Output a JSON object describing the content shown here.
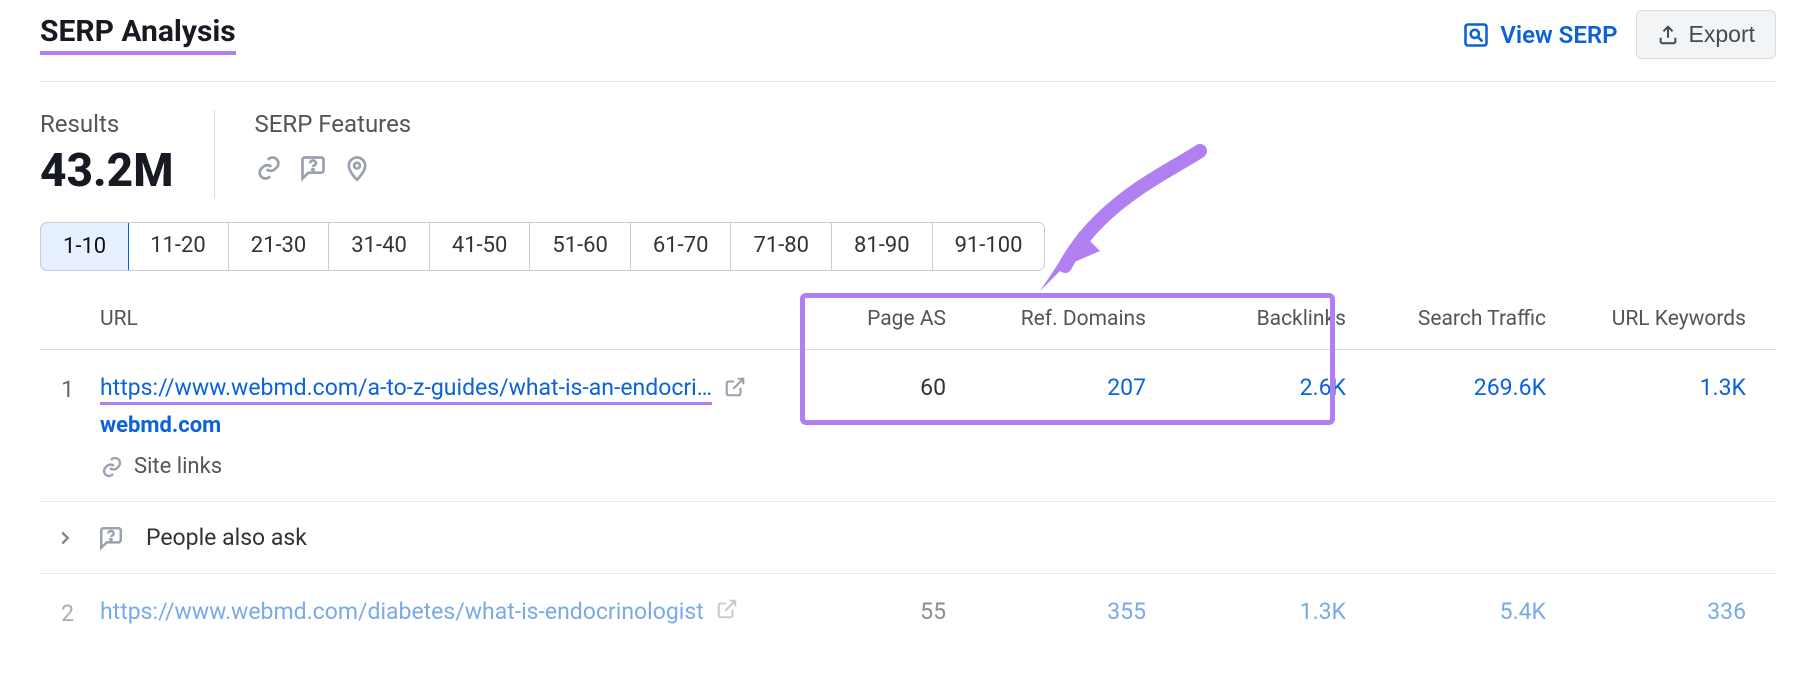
{
  "header": {
    "title": "SERP Analysis",
    "view_serp_label": "View SERP",
    "export_label": "Export"
  },
  "stats": {
    "results_label": "Results",
    "results_value": "43.2M",
    "features_label": "SERP Features"
  },
  "tabs": [
    "1-10",
    "11-20",
    "21-30",
    "31-40",
    "41-50",
    "51-60",
    "61-70",
    "71-80",
    "81-90",
    "91-100"
  ],
  "columns": {
    "url": "URL",
    "page_as": "Page AS",
    "ref_domains": "Ref. Domains",
    "backlinks": "Backlinks",
    "search_traffic": "Search Traffic",
    "url_keywords": "URL Keywords"
  },
  "rows": [
    {
      "idx": "1",
      "url": "https://www.webmd.com/a-to-z-guides/what-is-an-endocri…",
      "domain": "webmd.com",
      "sitelinks_label": "Site links",
      "page_as": "60",
      "ref_domains": "207",
      "backlinks": "2.6K",
      "search_traffic": "269.6K",
      "url_keywords": "1.3K"
    },
    {
      "idx": "2",
      "url": "https://www.webmd.com/diabetes/what-is-endocrinologist",
      "page_as": "55",
      "ref_domains": "355",
      "backlinks": "1.3K",
      "search_traffic": "5.4K",
      "url_keywords": "336"
    }
  ],
  "paa": {
    "label": "People also ask"
  },
  "colors": {
    "accent_purple": "#b080f0",
    "link_blue": "#0b63d6"
  }
}
